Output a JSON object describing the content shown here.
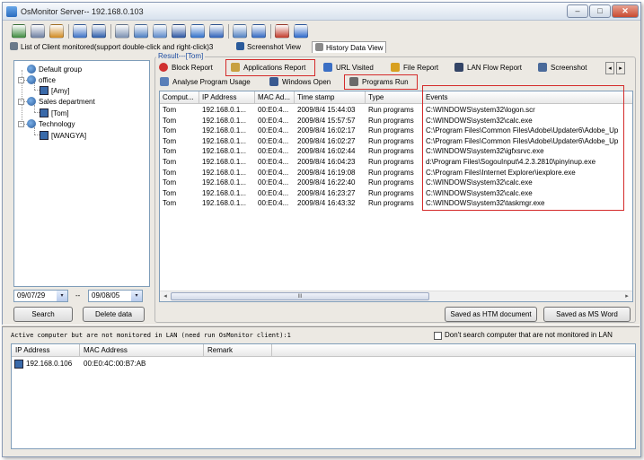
{
  "window": {
    "title": "OsMonitor Server-- 192.168.0.103",
    "min_glyph": "–",
    "max_glyph": "□",
    "close_glyph": "✕"
  },
  "toolbar_icons": [
    {
      "name": "connect-icon",
      "color": "#3c8a3c"
    },
    {
      "name": "settings-icon",
      "color": "#6c7ea0"
    },
    {
      "name": "users-icon",
      "color": "#d08a20"
    },
    {
      "name": "refresh-icon",
      "color": "#3a6fc4"
    },
    {
      "name": "block-icon",
      "color": "#2a5aa8"
    },
    {
      "name": "monitor-icon",
      "color": "#7a8fb0"
    },
    {
      "name": "network-icon",
      "color": "#4a7cc0"
    },
    {
      "name": "screen-icon",
      "color": "#5a88c8"
    },
    {
      "name": "pause-icon",
      "color": "#2a54a0"
    },
    {
      "name": "globe-icon",
      "color": "#2f6fc8"
    },
    {
      "name": "power-icon",
      "color": "#2c60b8"
    },
    {
      "name": "report-icon",
      "color": "#4f7fc0"
    },
    {
      "name": "lock-icon",
      "color": "#2f66c0"
    },
    {
      "name": "flag-icon",
      "color": "#c23a2a"
    },
    {
      "name": "help-icon",
      "color": "#2a66c8"
    }
  ],
  "top_tabs": [
    {
      "label": "List of Client monitored(support double-click and right-click)3"
    },
    {
      "label": "Screenshot View"
    },
    {
      "label": "History Data View",
      "active": true
    }
  ],
  "tree": {
    "items": [
      {
        "label": "Default group"
      },
      {
        "label": "office"
      },
      {
        "label": "[Amy]"
      },
      {
        "label": "Sales department"
      },
      {
        "label": "[Tom]"
      },
      {
        "label": "Technology"
      },
      {
        "label": "[WANGYA]"
      }
    ]
  },
  "dates": {
    "from": "09/07/29",
    "separator": "--",
    "to": "09/08/05",
    "dropdown_glyph": "▾"
  },
  "left_buttons": {
    "search": "Search",
    "delete": "Delete data"
  },
  "result": {
    "legend": "Result---[Tom]",
    "tabs_row1": [
      {
        "label": "Block Report",
        "icon": "block-report-icon",
        "color": "#d03030"
      },
      {
        "label": "Applications Report",
        "icon": "applications-report-icon",
        "color": "#c8a040"
      },
      {
        "label": "URL Visited",
        "icon": "url-visited-icon",
        "color": "#3b6fc4"
      },
      {
        "label": "File Report",
        "icon": "file-report-icon",
        "color": "#d8a020"
      },
      {
        "label": "LAN Flow Report",
        "icon": "lan-flow-report-icon",
        "color": "#334466"
      },
      {
        "label": "Screenshot",
        "icon": "screenshot-tab-icon",
        "color": "#4a6a9a"
      }
    ],
    "tabs_row2": [
      {
        "label": "Analyse Program Usage",
        "icon": "analyse-program-icon",
        "color": "#5a7fb8"
      },
      {
        "label": "Windows Open",
        "icon": "windows-open-icon",
        "color": "#3a5a90"
      },
      {
        "label": "Programs Run",
        "icon": "programs-run-icon",
        "color": "#6a6a6a"
      }
    ],
    "scroll_arrows": [
      "◂",
      "▸"
    ],
    "columns": [
      "Comput...",
      "IP Address",
      "MAC Ad...",
      "Time stamp",
      "Type",
      "Events"
    ],
    "rows": [
      [
        "Tom",
        "192.168.0.1...",
        "00:E0:4...",
        "2009/8/4 15:44:03",
        "Run programs",
        "C:\\WINDOWS\\system32\\logon.scr"
      ],
      [
        "Tom",
        "192.168.0.1...",
        "00:E0:4...",
        "2009/8/4 15:57:57",
        "Run programs",
        "C:\\WINDOWS\\system32\\calc.exe"
      ],
      [
        "Tom",
        "192.168.0.1...",
        "00:E0:4...",
        "2009/8/4 16:02:17",
        "Run programs",
        "C:\\Program Files\\Common Files\\Adobe\\Updater6\\Adobe_Up"
      ],
      [
        "Tom",
        "192.168.0.1...",
        "00:E0:4...",
        "2009/8/4 16:02:27",
        "Run programs",
        "C:\\Program Files\\Common Files\\Adobe\\Updater6\\Adobe_Up"
      ],
      [
        "Tom",
        "192.168.0.1...",
        "00:E0:4...",
        "2009/8/4 16:02:44",
        "Run programs",
        "C:\\WINDOWS\\system32\\igfxsrvc.exe"
      ],
      [
        "Tom",
        "192.168.0.1...",
        "00:E0:4...",
        "2009/8/4 16:04:23",
        "Run programs",
        "d:\\Program Files\\SogouInput\\4.2.3.2810\\pinyinup.exe"
      ],
      [
        "Tom",
        "192.168.0.1...",
        "00:E0:4...",
        "2009/8/4 16:19:08",
        "Run programs",
        "C:\\Program Files\\Internet Explorer\\iexplore.exe"
      ],
      [
        "Tom",
        "192.168.0.1...",
        "00:E0:4...",
        "2009/8/4 16:22:40",
        "Run programs",
        "C:\\WINDOWS\\system32\\calc.exe"
      ],
      [
        "Tom",
        "192.168.0.1...",
        "00:E0:4...",
        "2009/8/4 16:23:27",
        "Run programs",
        "C:\\WINDOWS\\system32\\calc.exe"
      ],
      [
        "Tom",
        "192.168.0.1...",
        "00:E0:4...",
        "2009/8/4 16:43:32",
        "Run programs",
        "C:\\WINDOWS\\system32\\taskmgr.exe"
      ]
    ],
    "hscroll": {
      "left": "◂",
      "thumb": "III",
      "right": "▸"
    },
    "save_htm": "Saved as HTM document",
    "save_word": "Saved as MS Word"
  },
  "bottom": {
    "label": "Active computer but are not monitored in LAN (need run OsMonitor client):1",
    "checkbox_label": "Don't search computer that are not monitored in LAN",
    "columns": [
      "IP Address",
      "MAC Address",
      "Remark"
    ],
    "rows": [
      [
        "192.168.0.106",
        "00:E0:4C:00:B7:AB",
        ""
      ]
    ]
  },
  "colors": {
    "highlight_border": "#d42a2a",
    "tree_connector": "#999999"
  }
}
